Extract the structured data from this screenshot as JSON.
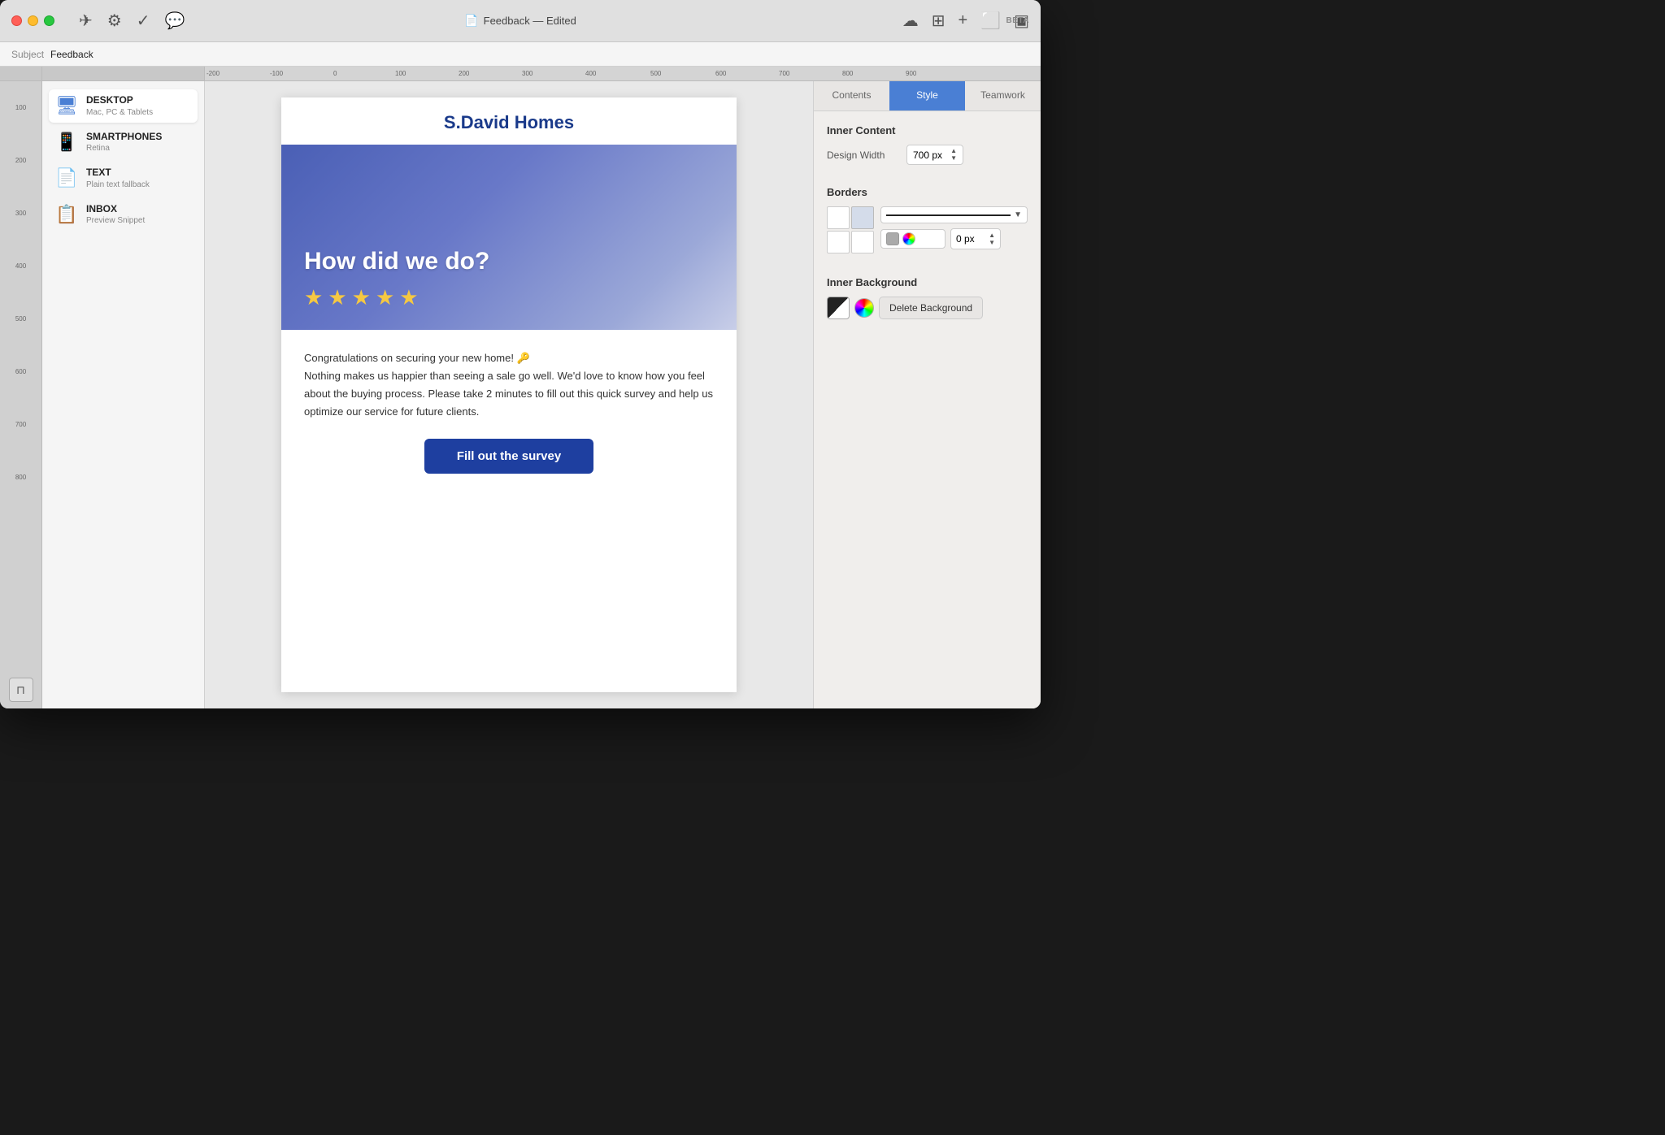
{
  "window": {
    "title": "Feedback — Edited",
    "beta_label": "BETA"
  },
  "titlebar": {
    "title": "Feedback — Edited",
    "edited_label": "— Edited",
    "beta_label": "BETA"
  },
  "subjectbar": {
    "label": "Subject",
    "value": "Feedback"
  },
  "devices": [
    {
      "id": "desktop",
      "name": "DESKTOP",
      "sub": "Mac, PC & Tablets",
      "icon": "🖥",
      "active": true
    },
    {
      "id": "smartphones",
      "name": "SMARTPHONES",
      "sub": "Retina",
      "icon": "📱",
      "active": false
    },
    {
      "id": "text",
      "name": "TEXT",
      "sub": "Plain text fallback",
      "icon": "📄",
      "active": false
    },
    {
      "id": "inbox",
      "name": "INBOX",
      "sub": "Preview Snippet",
      "icon": "📋",
      "active": false
    }
  ],
  "email": {
    "company_name": "S.David Homes",
    "hero_title": "How did we do?",
    "stars_count": 5,
    "body_text_1": "Congratulations on securing your new home! 🔑",
    "body_text_2": "Nothing makes us happier than seeing a sale go well. We'd love to know how you feel about the buying process. Please take 2 minutes to fill out this quick survey and help us optimize our service for future clients.",
    "cta_label": "Fill out the survey"
  },
  "right_panel": {
    "tabs": [
      {
        "id": "contents",
        "label": "Contents"
      },
      {
        "id": "style",
        "label": "Style",
        "active": true
      },
      {
        "id": "teamwork",
        "label": "Teamwork"
      }
    ],
    "inner_content": {
      "title": "Inner Content",
      "design_width_label": "Design Width",
      "design_width_value": "700 px"
    },
    "borders": {
      "title": "Borders",
      "px_value": "0 px"
    },
    "inner_background": {
      "title": "Inner Background",
      "delete_btn_label": "Delete Background"
    }
  },
  "ruler": {
    "marks": [
      "-200",
      "-100",
      "0",
      "100",
      "200",
      "300",
      "400",
      "500",
      "600",
      "700",
      "800",
      "900"
    ]
  },
  "vruler": {
    "marks": [
      "100",
      "200",
      "300",
      "400",
      "500",
      "600",
      "700",
      "800"
    ]
  }
}
